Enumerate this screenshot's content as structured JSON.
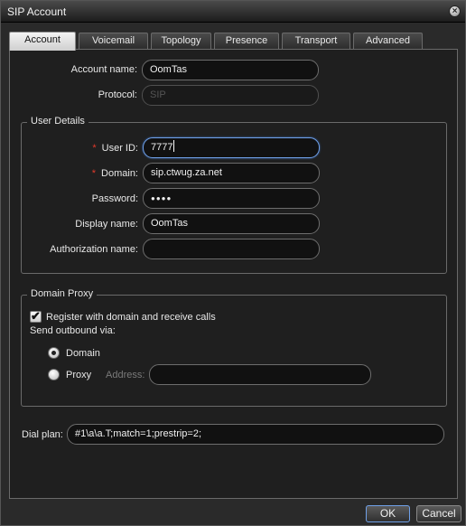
{
  "window": {
    "title": "SIP Account"
  },
  "tabs": [
    {
      "label": "Account"
    },
    {
      "label": "Voicemail"
    },
    {
      "label": "Topology"
    },
    {
      "label": "Presence"
    },
    {
      "label": "Transport"
    },
    {
      "label": "Advanced"
    }
  ],
  "account": {
    "name_label": "Account name:",
    "name_value": "OomTas",
    "protocol_label": "Protocol:",
    "protocol_value": "SIP"
  },
  "user_details": {
    "legend": "User Details",
    "required_mark": "*",
    "user_id_label": "User ID:",
    "user_id_value": "7777",
    "domain_label": "Domain:",
    "domain_value": "sip.ctwug.za.net",
    "password_label": "Password:",
    "password_value": "●●●●",
    "display_name_label": "Display name:",
    "display_name_value": "OomTas",
    "auth_name_label": "Authorization name:",
    "auth_name_value": ""
  },
  "domain_proxy": {
    "legend": "Domain Proxy",
    "register_label": "Register with domain and receive calls",
    "register_checked": true,
    "send_via_label": "Send outbound via:",
    "domain_option": "Domain",
    "proxy_option": "Proxy",
    "selected": "Domain",
    "address_label": "Address:",
    "address_value": ""
  },
  "dial_plan": {
    "label": "Dial plan:",
    "value": "#1\\a\\a.T;match=1;prestrip=2;"
  },
  "footer": {
    "ok_label": "OK",
    "cancel_label": "Cancel"
  },
  "colors": {
    "required": "#e23a2b",
    "focus": "#6fa0e8",
    "background": "#1f1f1f"
  }
}
